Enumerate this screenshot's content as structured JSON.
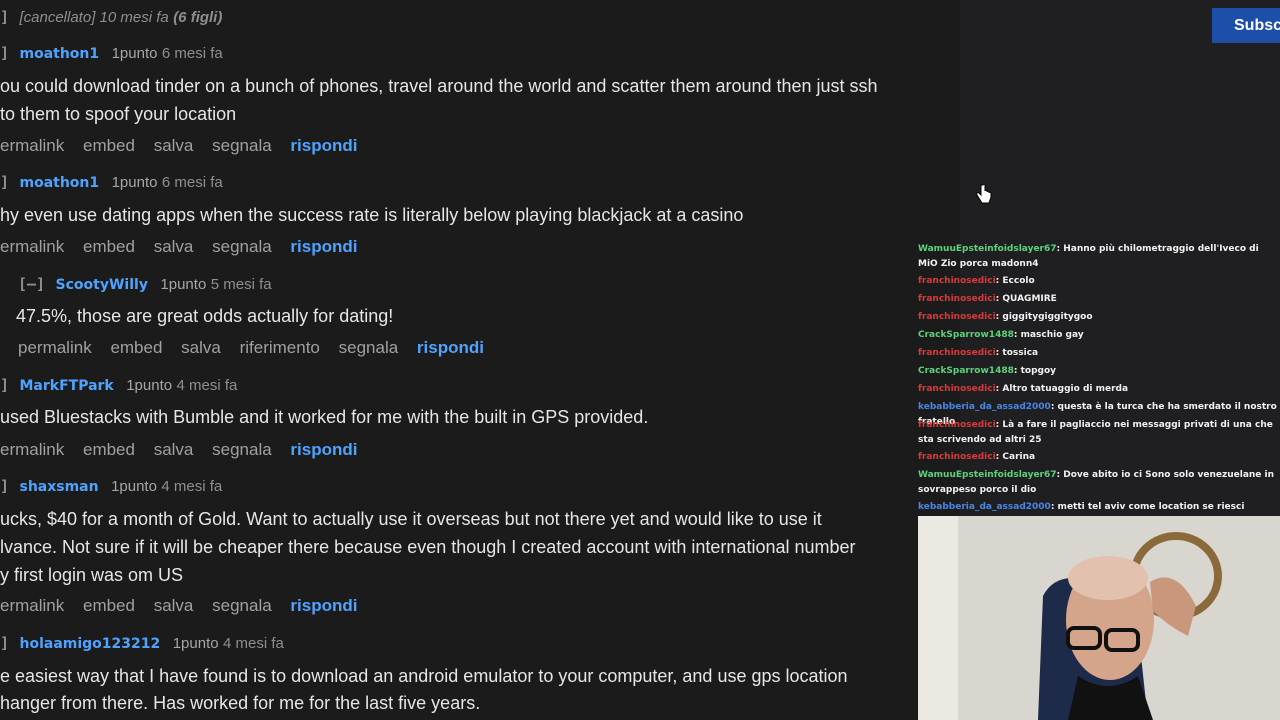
{
  "comments": [
    {
      "kind": "deleted",
      "tag": "]",
      "text": "[cancellato] 10 mesi fa",
      "extra": "(6 figli)"
    },
    {
      "tag": "]",
      "author": "moathon1",
      "score": "1punto",
      "age": "6 mesi fa",
      "lines": [
        "ou could download tinder on a bunch of phones, travel around the world and scatter them around then just ssh",
        "to them to spoof your location"
      ],
      "actions": [
        "ermalink",
        "embed",
        "salva",
        "segnala"
      ],
      "reply": "rispondi"
    },
    {
      "tag": "]",
      "author": "moathon1",
      "score": "1punto",
      "age": "6 mesi fa",
      "lines": [
        "hy even use dating apps when the success rate is literally below playing blackjack at a casino"
      ],
      "actions": [
        "ermalink",
        "embed",
        "salva",
        "segnala"
      ],
      "reply": "rispondi"
    },
    {
      "tag": "[–]",
      "author": "ScootyWilly",
      "score": "1punto",
      "age": "5 mesi fa",
      "lines": [
        "47.5%, those are great odds actually for dating!"
      ],
      "actions": [
        "permalink",
        "embed",
        "salva",
        "riferimento",
        "segnala"
      ],
      "reply": "rispondi"
    },
    {
      "tag": "]",
      "author": "MarkFTPark",
      "score": "1punto",
      "age": "4 mesi fa",
      "lines": [
        "used Bluestacks with Bumble and it worked for me with the built in GPS provided."
      ],
      "actions": [
        "ermalink",
        "embed",
        "salva",
        "segnala"
      ],
      "reply": "rispondi"
    },
    {
      "tag": "]",
      "author": "shaxsman",
      "score": "1punto",
      "age": "4 mesi fa",
      "lines": [
        "ucks, $40 for a month of Gold. Want to actually use it overseas but not there yet and would like to use it",
        "lvance. Not sure if it will be cheaper there because even though I created account with international number",
        "y first login was om US"
      ],
      "actions": [
        "ermalink",
        "embed",
        "salva",
        "segnala"
      ],
      "reply": "rispondi"
    },
    {
      "tag": "]",
      "author": "holaamigo123212",
      "score": "1punto",
      "age": "4 mesi fa",
      "lines": [
        "e easiest way that I have found is to download an android emulator to your computer, and use gps location",
        "hanger from there. Has worked for me for the last five years."
      ]
    }
  ],
  "subscribe_label": "Subsc",
  "chat": [
    {
      "user": "WamuuEpsteinfoidslayer67",
      "color": "green",
      "text": ": Hanno più chilometraggio dell'Iveco di MiO Zio porca madonn4"
    },
    {
      "user": "franchinosedici",
      "color": "red",
      "text": ": Eccolo"
    },
    {
      "user": "franchinosedici",
      "color": "red",
      "text": ": QUAGMIRE"
    },
    {
      "user": "franchinosedici",
      "color": "red",
      "text": ": giggitygiggitygoo"
    },
    {
      "user": "CrackSparrow1488",
      "color": "green",
      "text": ": maschio gay"
    },
    {
      "user": "franchinosedici",
      "color": "red",
      "text": ": tossica"
    },
    {
      "user": "CrackSparrow1488",
      "color": "green",
      "text": ": topgoy"
    },
    {
      "user": "franchinosedici",
      "color": "red",
      "text": ": Altro tatuaggio di merda"
    },
    {
      "user": "kebabberia_da_assad2000",
      "color": "blue",
      "text": ": questa è la turca che ha smerdato il nostro fratello"
    },
    {
      "user": "franchinosedici",
      "color": "red",
      "text": ": Là a fare il pagliaccio nei messaggi privati di una che sta scrivendo ad altri 25"
    },
    {
      "user": "franchinosedici",
      "color": "red",
      "text": ": Carina"
    },
    {
      "user": "WamuuEpsteinfoidslayer67",
      "color": "green",
      "text": ": Dove abito io ci Sono solo venezuelane in sovrappeso porco il dio"
    },
    {
      "user": "kebabberia_da_assad2000",
      "color": "blue",
      "text": ": metti tel aviv come location se riesci"
    }
  ]
}
